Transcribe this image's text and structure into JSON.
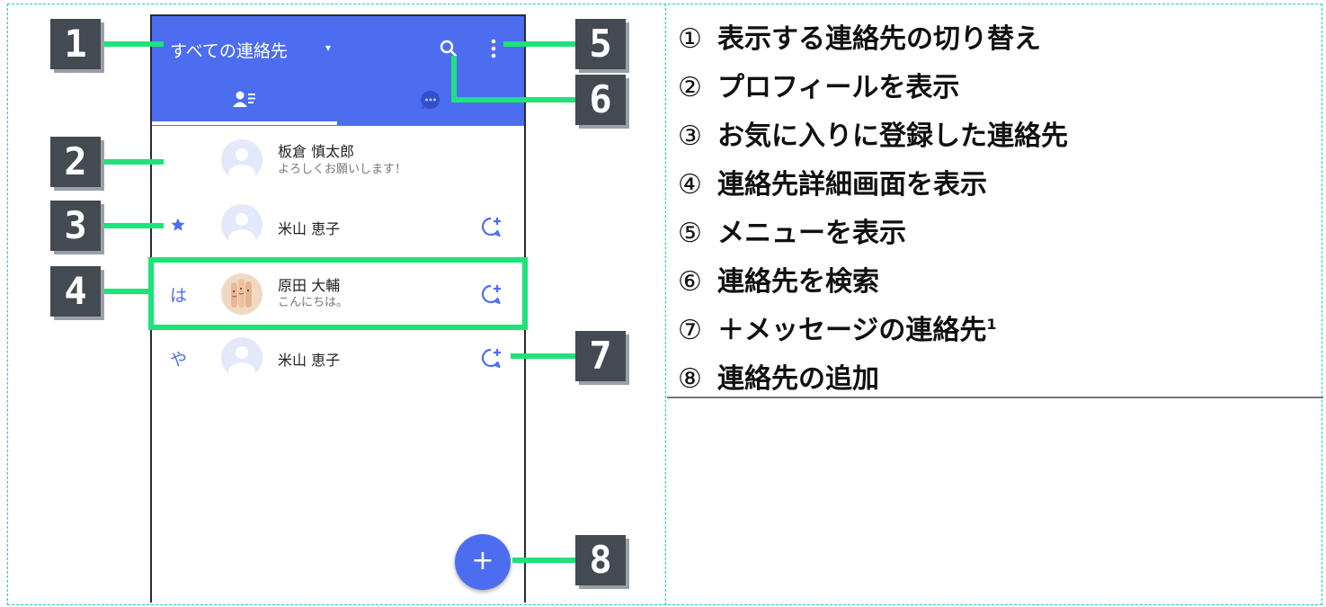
{
  "app_bar": {
    "title": "すべての連絡先",
    "caret": "▾",
    "accent_color": "#4d6df0",
    "icons": [
      "search-icon",
      "more-vert-icon"
    ],
    "tabs": [
      "contacts-tab-icon",
      "chat-tab-icon"
    ]
  },
  "profile": {
    "name": "板倉 慎太郎",
    "status": "よろしくお願いします！"
  },
  "contacts": [
    {
      "index": "★",
      "name": "米山 恵子",
      "status": "",
      "icon": "star-icon"
    },
    {
      "index": "は",
      "name": "原田 大輔",
      "status": "こんにちは。"
    },
    {
      "index": "や",
      "name": "米山 恵子",
      "status": ""
    }
  ],
  "fab": {
    "label": "+"
  },
  "highlight_color": "#1ee27a",
  "callouts": [
    "1",
    "2",
    "3",
    "4",
    "5",
    "6",
    "7",
    "8"
  ],
  "legend": [
    {
      "num": "①",
      "text": "表示する連絡先の切り替え"
    },
    {
      "num": "②",
      "text": "プロフィールを表示"
    },
    {
      "num": "③",
      "text": "お気に入りに登録した連絡先"
    },
    {
      "num": "④",
      "text": "連絡先詳細画面を表示"
    },
    {
      "num": "⑤",
      "text": "メニューを表示"
    },
    {
      "num": "⑥",
      "text": "連絡先を検索"
    },
    {
      "num": "⑦",
      "text": "＋メッセージの連絡先",
      "footnote": "1"
    },
    {
      "num": "⑧",
      "text": "連絡先の追加"
    }
  ]
}
